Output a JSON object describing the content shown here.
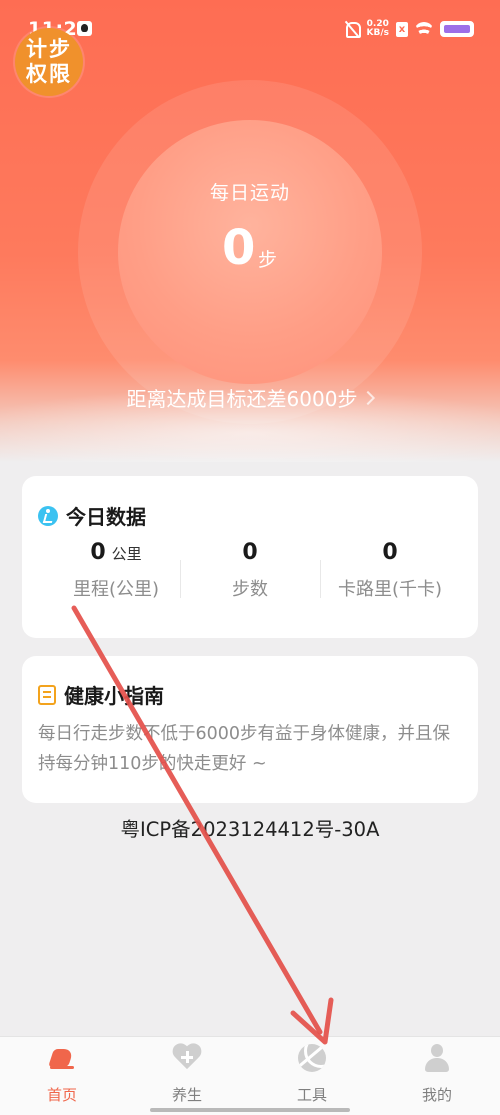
{
  "status_bar": {
    "time": "11:23",
    "net_speed_value": "0.20",
    "net_speed_unit": "KB/s",
    "sim_label": "x"
  },
  "badge": {
    "line1": "计步",
    "line2": "权限"
  },
  "hero": {
    "title": "每日运动",
    "steps": "0",
    "steps_unit": "步",
    "goal_text": "距离达成目标还差6000步"
  },
  "today": {
    "title": "今日数据",
    "stats": [
      {
        "value": "0",
        "unit": "公里",
        "label": "里程(公里)"
      },
      {
        "value": "0",
        "unit": "",
        "label": "步数"
      },
      {
        "value": "0",
        "unit": "",
        "label": "卡路里(千卡)"
      }
    ]
  },
  "guide": {
    "title": "健康小指南",
    "text": "每日行走步数不低于6000步有益于身体健康，并且保持每分钟110步的快走更好 ~"
  },
  "footer": {
    "icp": "粤ICP备2023124412号-30A"
  },
  "tabbar": {
    "tabs": [
      {
        "label": "首页",
        "icon": "running-shoe-icon",
        "active": true
      },
      {
        "label": "养生",
        "icon": "heart-plus-icon",
        "active": false
      },
      {
        "label": "工具",
        "icon": "ball-icon",
        "active": false
      },
      {
        "label": "我的",
        "icon": "user-icon",
        "active": false
      }
    ]
  },
  "colors": {
    "brand": "#fe6d53",
    "badge": "#f0912c",
    "active_tab": "#f0664b",
    "annotation_arrow": "#e4504a"
  }
}
